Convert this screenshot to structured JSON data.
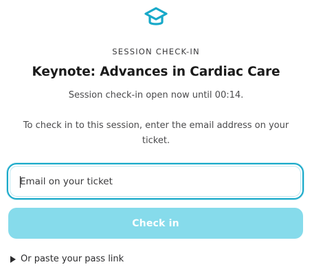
{
  "header": {
    "logo_icon": "graduation-cap-icon",
    "accent_color": "#18a9c9",
    "eyebrow": "SESSION CHECK-IN",
    "title": "Keynote: Advances in Cardiac Care",
    "open_note": "Session check-in open now until 00:14."
  },
  "form": {
    "instructions": "To check in to this session, enter the email address on your ticket.",
    "email_placeholder": "Email on your ticket",
    "email_value": "",
    "submit_label": "Check in",
    "submit_color": "#86dbeb"
  },
  "footer": {
    "disclosure_icon": "triangle-right-icon",
    "paste_link_label": "Or paste your pass link"
  }
}
